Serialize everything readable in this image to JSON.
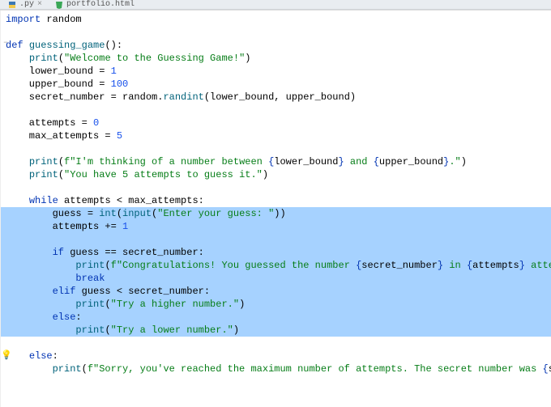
{
  "tabs": {
    "left": {
      "label": ".py"
    },
    "right": {
      "label": "portfolio.html"
    }
  },
  "code": {
    "l01a": "import",
    "l01b": " random",
    "l02": "",
    "l03a": "def",
    "l03b": " ",
    "l03c": "guessing_game",
    "l03d": "():",
    "l04a": "    ",
    "l04b": "print",
    "l04c": "(",
    "l04d": "\"Welcome to the Guessing Game!\"",
    "l04e": ")",
    "l05a": "    lower_bound = ",
    "l05b": "1",
    "l06a": "    upper_bound = ",
    "l06b": "100",
    "l07a": "    secret_number = random.",
    "l07b": "randint",
    "l07c": "(lower_bound, upper_bound)",
    "l08": "",
    "l09a": "    attempts = ",
    "l09b": "0",
    "l10a": "    max_attempts = ",
    "l10b": "5",
    "l11": "",
    "l12a": "    ",
    "l12b": "print",
    "l12c": "(",
    "l12d": "f\"I'm thinking of a number between ",
    "l12e": "{",
    "l12f": "lower_bound",
    "l12g": "}",
    "l12h": " and ",
    "l12i": "{",
    "l12j": "upper_bound",
    "l12k": "}",
    "l12l": ".\"",
    "l12m": ")",
    "l13a": "    ",
    "l13b": "print",
    "l13c": "(",
    "l13d": "\"You have 5 attempts to guess it.\"",
    "l13e": ")",
    "l14": "",
    "l15a": "    ",
    "l15b": "while",
    "l15c": " attempts < max_attempts:",
    "l16a": "        guess = ",
    "l16b": "int",
    "l16c": "(",
    "l16d": "input",
    "l16e": "(",
    "l16f": "\"Enter your guess: \"",
    "l16g": "))",
    "l17a": "        attempts += ",
    "l17b": "1",
    "l18": "",
    "l19a": "        ",
    "l19b": "if",
    "l19c": " guess == secret_number:",
    "l20a": "            ",
    "l20b": "print",
    "l20c": "(",
    "l20d": "f\"Congratulations! You guessed the number ",
    "l20e": "{",
    "l20f": "secret_number",
    "l20g": "}",
    "l20h": " in ",
    "l20i": "{",
    "l20j": "attempts",
    "l20k": "}",
    "l20l": " attempts.\"",
    "l20m": ")",
    "l21a": "            ",
    "l21b": "break",
    "l22a": "        ",
    "l22b": "elif",
    "l22c": " guess < secret_number:",
    "l23a": "            ",
    "l23b": "print",
    "l23c": "(",
    "l23d": "\"Try a higher number.\"",
    "l23e": ")",
    "l24a": "        ",
    "l24b": "else",
    "l24c": ":",
    "l25a": "            ",
    "l25b": "print",
    "l25c": "(",
    "l25d": "\"Try a lower number.\"",
    "l25e": ")",
    "l26": "",
    "l27a": "    ",
    "l27b": "else",
    "l27c": ":",
    "l28a": "        ",
    "l28b": "print",
    "l28c": "(",
    "l28d": "f\"Sorry, you've reached the maximum number of attempts. The secret number was ",
    "l28e": "{",
    "l28f": "secret_number",
    "l28g": "}",
    "l28h": ".\"",
    "l28i": ")"
  },
  "gutter": {
    "bulb": "💡"
  }
}
